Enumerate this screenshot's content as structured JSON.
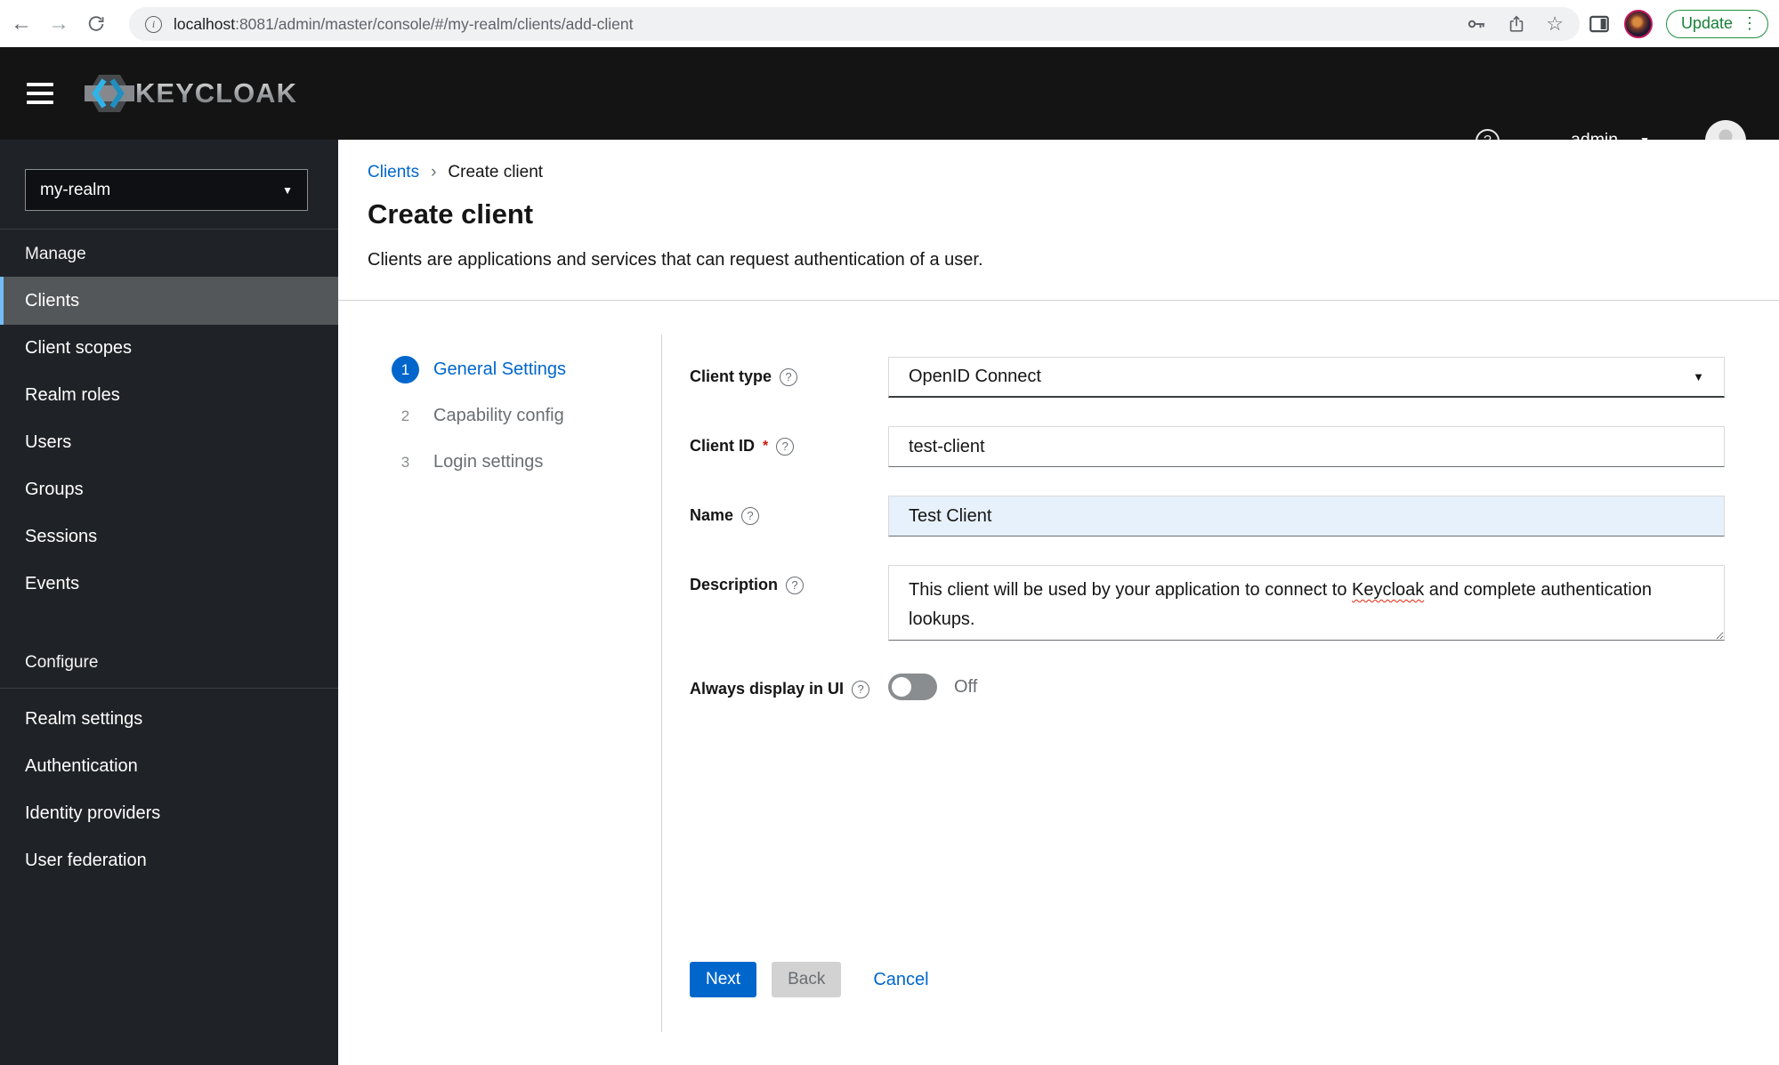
{
  "browser": {
    "url_domain": "localhost",
    "url_path": ":8081/admin/master/console/#/my-realm/clients/add-client",
    "update_label": "Update",
    "menu_dots": "⋮"
  },
  "header": {
    "brand": "KEYCLOAK",
    "user": "admin"
  },
  "sidebar": {
    "realm": "my-realm",
    "manage_title": "Manage",
    "manage_items": [
      "Clients",
      "Client scopes",
      "Realm roles",
      "Users",
      "Groups",
      "Sessions",
      "Events"
    ],
    "configure_title": "Configure",
    "configure_items": [
      "Realm settings",
      "Authentication",
      "Identity providers",
      "User federation"
    ]
  },
  "breadcrumb": {
    "parent": "Clients",
    "separator": "›",
    "current": "Create client"
  },
  "page": {
    "title": "Create client",
    "subtitle": "Clients are applications and services that can request authentication of a user."
  },
  "wizard_steps": [
    {
      "num": "1",
      "label": "General Settings"
    },
    {
      "num": "2",
      "label": "Capability config"
    },
    {
      "num": "3",
      "label": "Login settings"
    }
  ],
  "form": {
    "client_type": {
      "label": "Client type",
      "value": "OpenID Connect"
    },
    "client_id": {
      "label": "Client ID",
      "required_mark": "*",
      "value": "test-client"
    },
    "name": {
      "label": "Name",
      "value": "Test Client"
    },
    "description": {
      "label": "Description",
      "value": "This client will be used by your application to connect to Keycloak and complete authentication lookups.",
      "misspelled_word": "Keycloak"
    },
    "always_display": {
      "label": "Always display in UI",
      "state_label": "Off"
    }
  },
  "actions": {
    "next": "Next",
    "back": "Back",
    "cancel": "Cancel"
  },
  "colors": {
    "primary": "#0066cc",
    "header_bg": "#141414",
    "sidebar_bg": "#1f2226",
    "active_nav_bg": "#54575a",
    "active_nav_border": "#73bcf7",
    "update_green": "#188038",
    "required_red": "#c9190b",
    "name_field_bg": "#e7f1fb"
  }
}
